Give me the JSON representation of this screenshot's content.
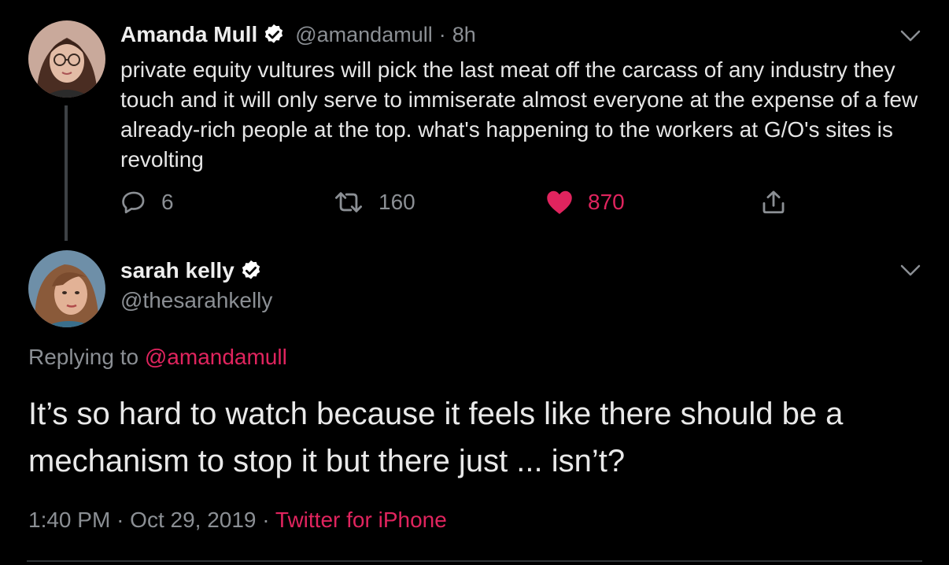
{
  "parent_tweet": {
    "display_name": "Amanda Mull",
    "handle": "@amandamull",
    "separator": "·",
    "time_ago": "8h",
    "text": "private equity vultures will pick the last meat off the carcass of any industry they touch and it will only serve to immiserate almost everyone at the expense of a few already-rich people at the top. what's happening to the workers at G/O's sites is revolting",
    "replies": "6",
    "retweets": "160",
    "likes": "870",
    "liked": true
  },
  "main_tweet": {
    "display_name": "sarah kelly",
    "handle": "@thesarahkelly",
    "replying_prefix": "Replying to",
    "replying_to": "@amandamull",
    "text": "It’s so hard to watch because it feels like there should be a mechanism to stop it but there just ... isn’t?",
    "time": "1:40 PM",
    "date_sep": "·",
    "date": "Oct 29, 2019",
    "source_sep": "·",
    "source": "Twitter for iPhone"
  },
  "colors": {
    "background": "#000000",
    "text": "#e6e6e6",
    "muted": "#8b8f94",
    "accent": "#e0245e"
  },
  "icons": [
    "verified-badge-icon",
    "chevron-down-icon",
    "reply-icon",
    "retweet-icon",
    "heart-icon",
    "share-icon"
  ]
}
